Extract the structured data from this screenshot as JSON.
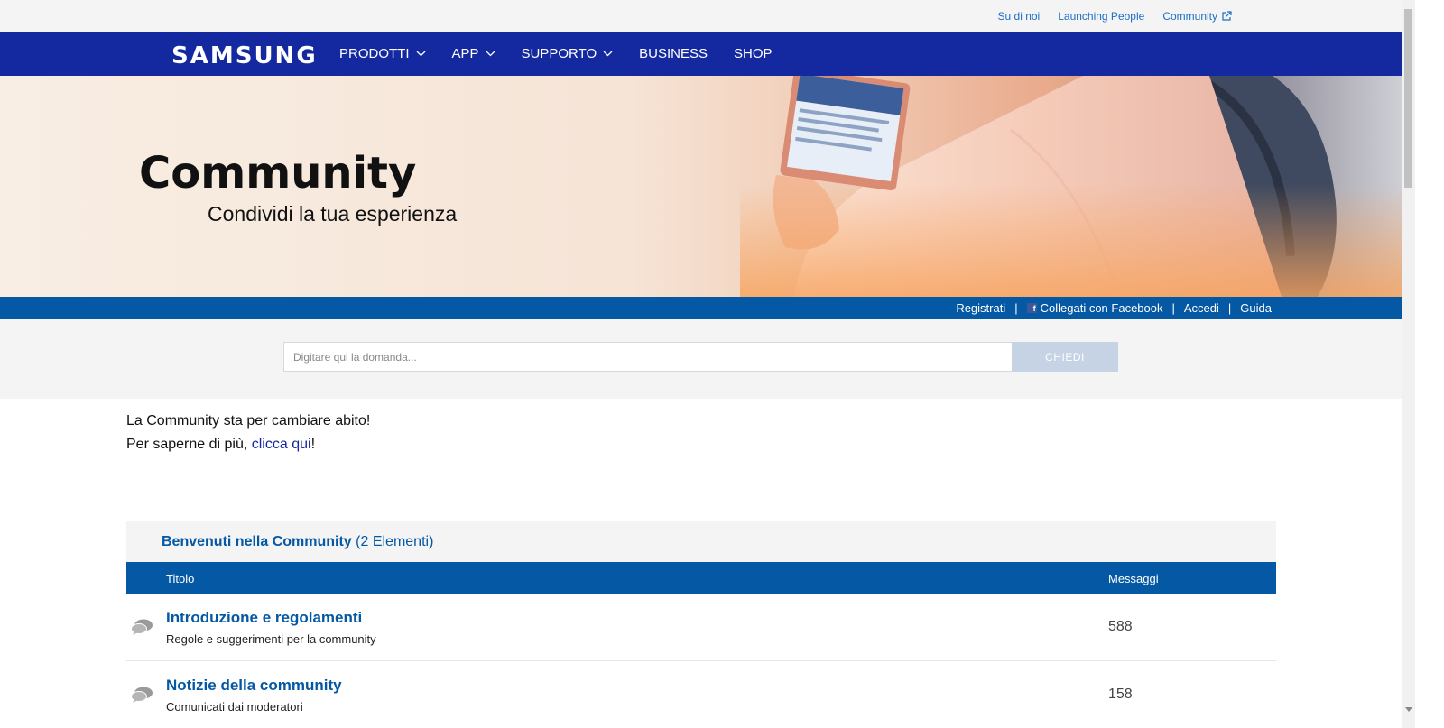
{
  "utility": {
    "links": [
      "Su di noi",
      "Launching People",
      "Community"
    ]
  },
  "nav": {
    "logo": "SAMSUNG",
    "items": [
      {
        "label": "PRODOTTI",
        "dropdown": true
      },
      {
        "label": "APP",
        "dropdown": true
      },
      {
        "label": "SUPPORTO",
        "dropdown": true
      },
      {
        "label": "BUSINESS",
        "dropdown": false
      },
      {
        "label": "SHOP",
        "dropdown": false
      }
    ]
  },
  "hero": {
    "title": "Community",
    "subtitle": "Condividi la tua esperienza"
  },
  "account": {
    "register": "Registrati",
    "facebook": "Collegati con Facebook",
    "login": "Accedi",
    "help": "Guida",
    "separator": "|"
  },
  "search": {
    "placeholder": "Digitare qui la domanda...",
    "button": "CHIEDI"
  },
  "announcement": {
    "line1": "La Community sta per cambiare abito!",
    "line2_prefix": "Per saperne di più, ",
    "line2_link": "clicca qui",
    "line2_suffix": "!"
  },
  "board": {
    "title": "Benvenuti nella Community",
    "count": "(2 Elementi)",
    "col_title": "Titolo",
    "col_messages": "Messaggi",
    "rows": [
      {
        "title": "Introduzione e regolamenti",
        "desc": "Regole e suggerimenti per la community",
        "messages": "588"
      },
      {
        "title": "Notizie della community",
        "desc": "Comunicati dai moderatori",
        "messages": "158"
      }
    ]
  },
  "colors": {
    "nav_blue": "#1428a0",
    "bar_blue": "#0558a4",
    "link_blue": "#1a6fc4",
    "light_gray": "#f4f4f4"
  },
  "icons": [
    "external-link-icon",
    "chevron-down-icon",
    "facebook-icon",
    "discussion-bubbles-icon"
  ]
}
